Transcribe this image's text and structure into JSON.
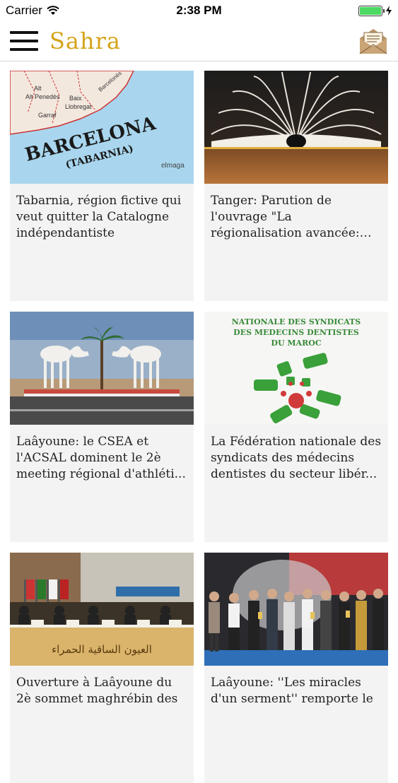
{
  "status_bar": {
    "carrier": "Carrier",
    "time": "2:38 PM",
    "battery_level": 1.0,
    "battery_color": "#4cd964"
  },
  "header": {
    "menu_icon": "hamburger-icon",
    "brand": "Sahra",
    "brand_color": "#d4a419",
    "mail_icon": "envelope-icon"
  },
  "images": {
    "barcelona_title": "BARCELONA",
    "barcelona_subtitle": "(TABARNIA)",
    "map_labels": [
      "Alt Penedès",
      "Baix Llobregat",
      "Garraf",
      "Barcelonès"
    ],
    "map_watermark": "elmaga",
    "fed_line1": "NATIONALE DES SYNDICATS",
    "fed_line2": "DES MEDECINS DENTISTES",
    "fed_line3": "DU MAROC",
    "banner_arabic": "العيون الساقية الحمراء"
  },
  "articles": [
    {
      "title": "Tabarnia, région fictive qui veut quitter la Catalogne indépendantiste",
      "image": "barcelona-map"
    },
    {
      "title": "Tanger: Parution de l'ouvrage \"La régionalisation avancée: e...",
      "image": "open-book"
    },
    {
      "title": "Laâyoune: le CSEA et l'ACSAL dominent le 2è meeting régional d'athléti...",
      "image": "camel-roundabout"
    },
    {
      "title": "La Fédération nationale des syndicats des médecins dentistes du secteur libér...",
      "image": "dentists-logo"
    },
    {
      "title": "Ouverture à Laâyoune du 2è sommet maghrébin des",
      "image": "conference-panel"
    },
    {
      "title": "Laâyoune: ''Les miracles d'un serment'' remporte le",
      "image": "award-ceremony"
    }
  ]
}
